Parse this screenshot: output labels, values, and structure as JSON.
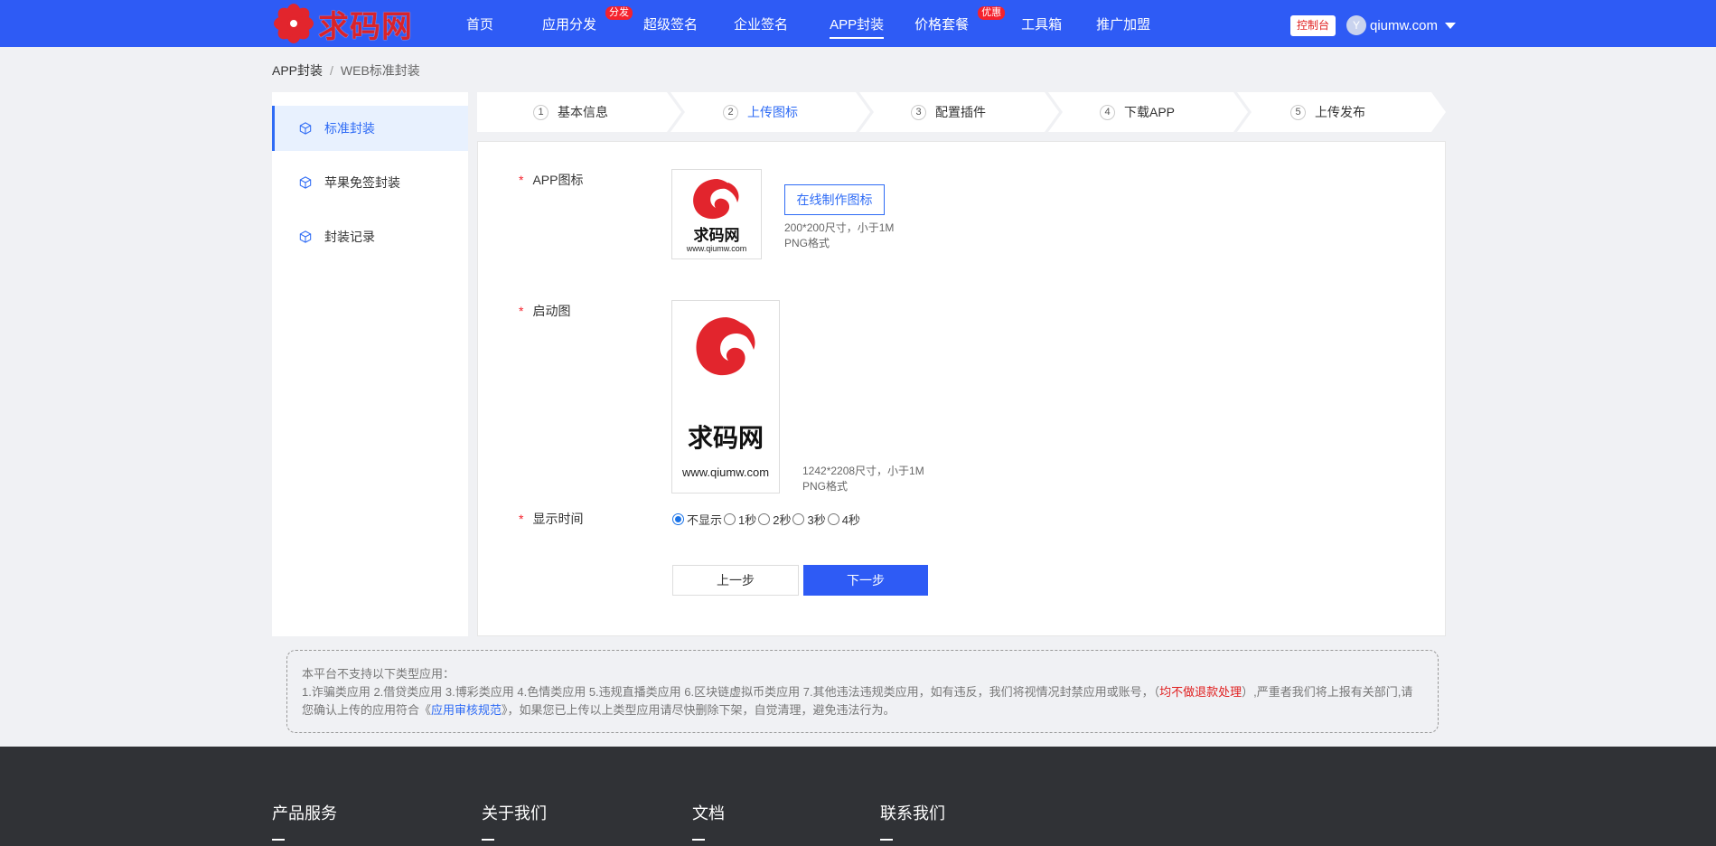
{
  "header": {
    "logo_text": "求码网",
    "nav": [
      {
        "label": "首页",
        "badge": ""
      },
      {
        "label": "应用分发",
        "badge": "分发"
      },
      {
        "label": "超级签名",
        "badge": ""
      },
      {
        "label": "企业签名",
        "badge": ""
      },
      {
        "label": "APP封装",
        "badge": ""
      },
      {
        "label": "价格套餐",
        "badge": "优惠"
      },
      {
        "label": "工具箱",
        "badge": ""
      },
      {
        "label": "推广加盟",
        "badge": ""
      }
    ],
    "active_nav": "APP封装",
    "console_label": "控制台",
    "user_avatar_letter": "Y",
    "user_name": "qiumw.com",
    "accent_color": "#2e5bf5"
  },
  "breadcrumb": {
    "root": "APP封装",
    "separator": "/",
    "current": "WEB标准封装"
  },
  "sidebar": {
    "items": [
      {
        "label": "标准封装",
        "icon": "cube-icon",
        "active": true
      },
      {
        "label": "苹果免签封装",
        "icon": "cube-icon",
        "active": false
      },
      {
        "label": "封装记录",
        "icon": "cube-icon",
        "active": false
      }
    ]
  },
  "steps": [
    {
      "num": "1",
      "label": "基本信息"
    },
    {
      "num": "2",
      "label": "上传图标"
    },
    {
      "num": "3",
      "label": "配置插件"
    },
    {
      "num": "4",
      "label": "下载APP"
    },
    {
      "num": "5",
      "label": "上传发布"
    }
  ],
  "active_step": 2,
  "form": {
    "required_mark": "*",
    "app_icon_label": "APP图标",
    "make_icon_button": "在线制作图标",
    "app_icon_tip_size": "200*200尺寸，小于1M",
    "app_icon_tip_format": "PNG格式",
    "app_icon_logo_text": "求码网",
    "app_icon_logo_url": "www.qiumw.com",
    "splash_label": "启动图",
    "splash_tip_size": "1242*2208尺寸，小于1M",
    "splash_tip_format": "PNG格式",
    "splash_logo_text": "求码网",
    "splash_logo_url": "www.qiumw.com",
    "display_time_label": "显示时间",
    "display_options": [
      "不显示",
      "1秒",
      "2秒",
      "3秒",
      "4秒"
    ],
    "display_selected": "不显示",
    "prev_button": "上一步",
    "next_button": "下一步"
  },
  "notice": {
    "title": "本平台不支持以下类型应用：",
    "line_a": "1.诈骗类应用 2.借贷类应用 3.博彩类应用 4.色情类应用 5.违规直播类应用 6.区块链虚拟币类应用 7.其他违法违规类应用，如有违反，我们将视情况封禁应用或账号，（",
    "red_text": "均不做退款处理",
    "line_b": "）,严重者我们将上报有关部门,请您确认上传的应用符合《",
    "link_text": "应用审核规范",
    "line_c": "》，如果您已上传以上类型应用请尽快删除下架，自觉清理，避免违法行为。"
  },
  "footer": {
    "columns": [
      "产品服务",
      "关于我们",
      "文档",
      "联系我们"
    ]
  }
}
